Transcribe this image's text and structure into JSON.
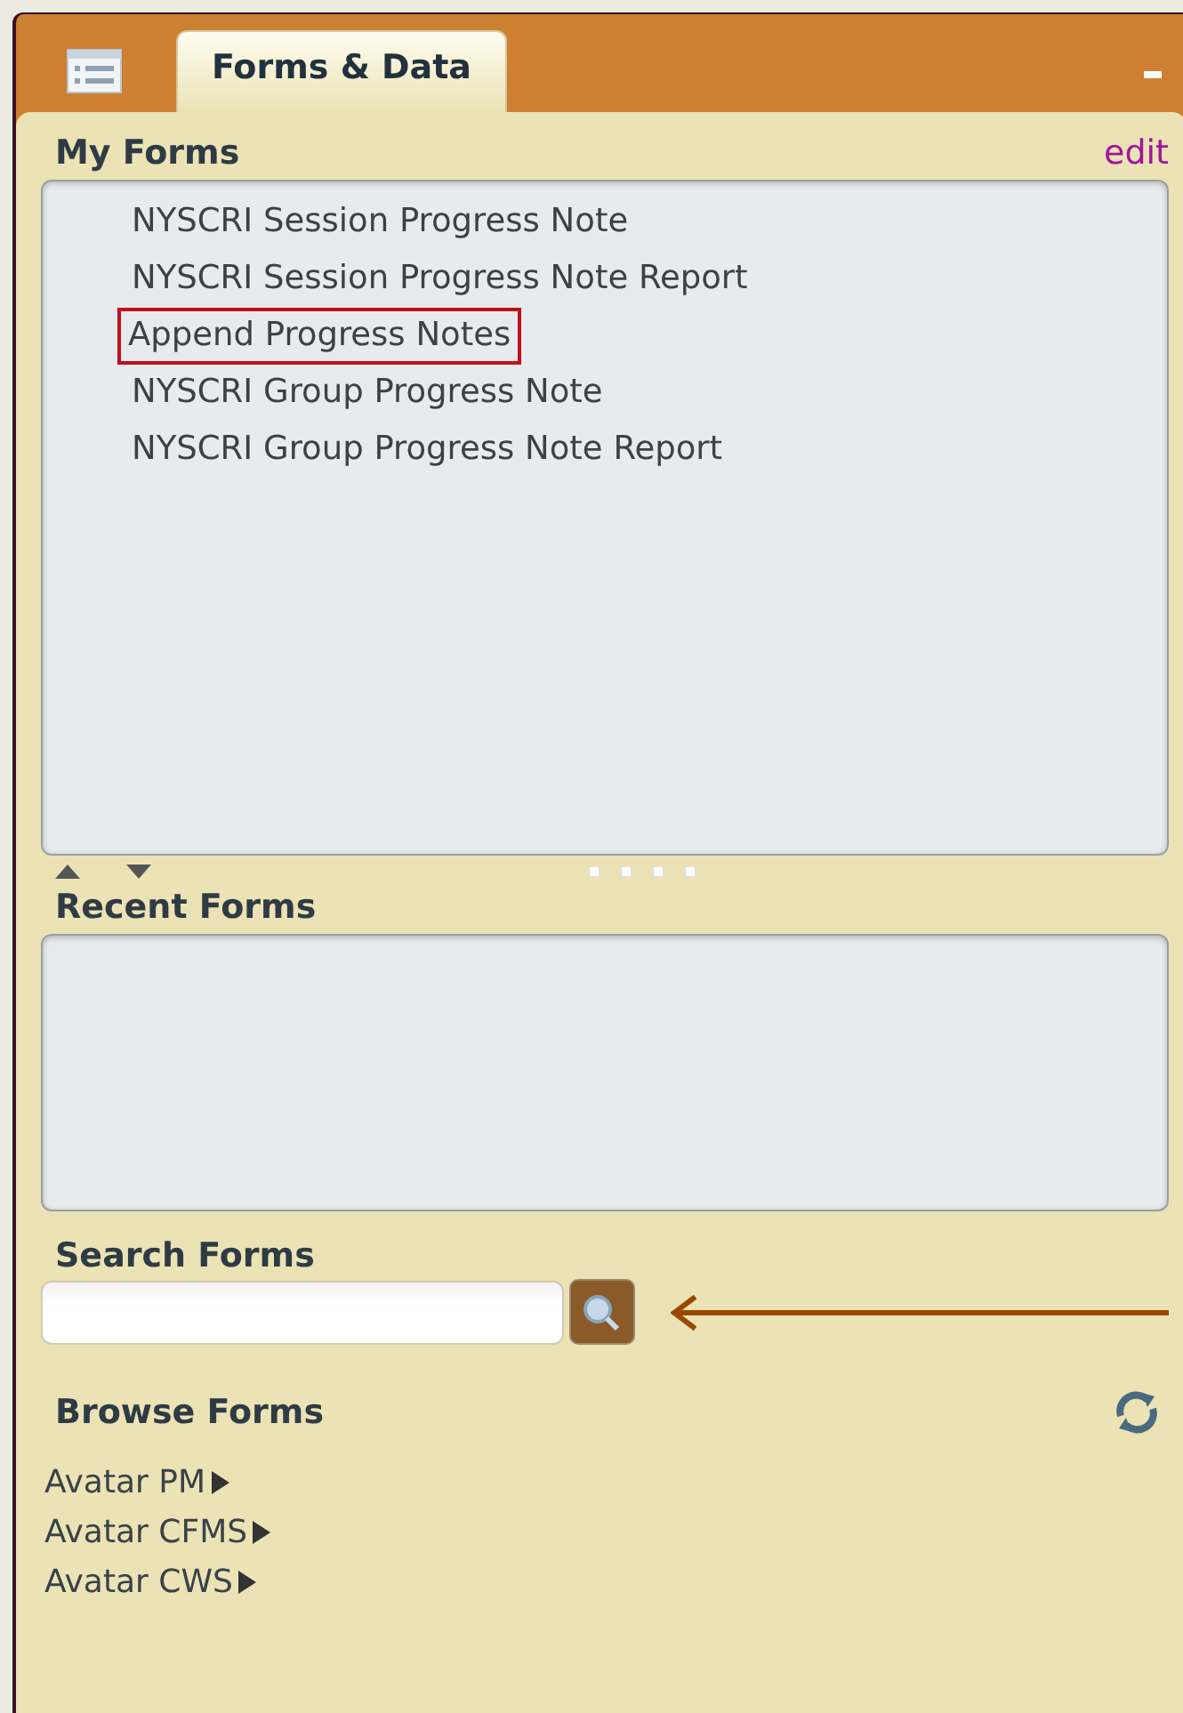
{
  "tab": {
    "label": "Forms & Data",
    "selected": true
  },
  "my_forms": {
    "title": "My Forms",
    "edit_link": "edit",
    "items": [
      {
        "label": "NYSCRI Session Progress Note",
        "highlighted": false
      },
      {
        "label": "NYSCRI Session Progress Note Report",
        "highlighted": false
      },
      {
        "label": "Append Progress Notes",
        "highlighted": true
      },
      {
        "label": "NYSCRI Group Progress Note",
        "highlighted": false
      },
      {
        "label": "NYSCRI Group Progress Note Report",
        "highlighted": false
      }
    ]
  },
  "recent_forms": {
    "title": "Recent Forms"
  },
  "search_forms": {
    "title": "Search Forms"
  },
  "browse_forms": {
    "title": "Browse Forms",
    "items": [
      {
        "label": "Avatar PM"
      },
      {
        "label": "Avatar CFMS"
      },
      {
        "label": "Avatar CWS"
      }
    ]
  }
}
